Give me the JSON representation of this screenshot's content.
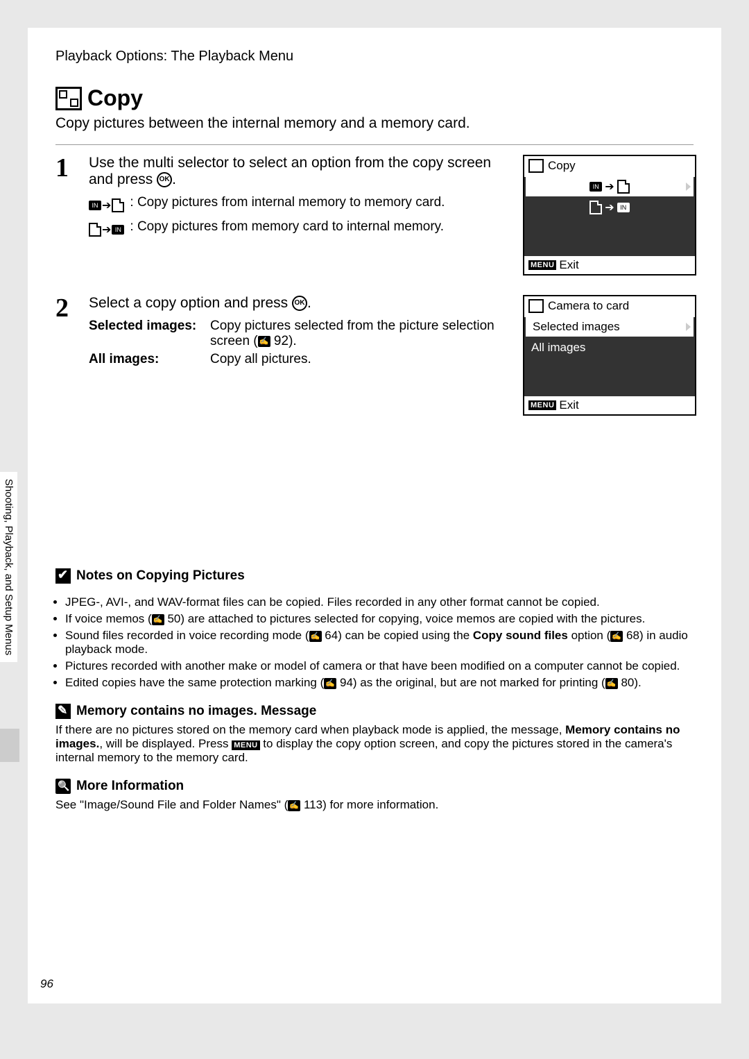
{
  "breadcrumb": "Playback Options: The Playback Menu",
  "heading": "Copy",
  "intro": "Copy pictures between the internal memory and a memory card.",
  "step1": {
    "num": "1",
    "title_a": "Use the multi selector to select an option from the copy screen and press ",
    "title_b": ".",
    "ok": "OK",
    "in_to_card": ": Copy pictures from internal memory to memory card.",
    "card_to_in": ": Copy pictures from memory card to internal memory."
  },
  "step2": {
    "num": "2",
    "title_a": "Select a copy option and press ",
    "title_b": ".",
    "ok": "OK",
    "opt1_label": "Selected images",
    "opt1_desc_a": "Copy pictures selected from the picture selection screen (",
    "opt1_ref": "92",
    "opt1_desc_b": ").",
    "opt2_label": "All images",
    "opt2_desc": "Copy all pictures."
  },
  "screen1": {
    "title": "Copy",
    "exit": "Exit",
    "menu": "MENU"
  },
  "screen2": {
    "title": "Camera to card",
    "row1": "Selected images",
    "row2": "All images",
    "exit": "Exit",
    "menu": "MENU"
  },
  "notes": {
    "head": "Notes on Copying Pictures",
    "b1": "JPEG-, AVI-, and WAV-format files can be copied. Files recorded in any other format cannot be copied.",
    "b2a": "If voice memos (",
    "b2ref": "50",
    "b2b": ") are attached to pictures selected for copying, voice memos are copied with the pictures.",
    "b3a": "Sound files recorded in voice recording mode (",
    "b3ref1": "64",
    "b3b": ") can be copied using the ",
    "b3bold": "Copy sound files",
    "b3c": " option (",
    "b3ref2": "68",
    "b3d": ") in audio playback mode.",
    "b4": "Pictures recorded with another make or model of camera or that have been modified on a computer cannot be copied.",
    "b5a": "Edited copies have the same protection marking (",
    "b5ref1": "94",
    "b5b": ") as the original, but are not marked for printing (",
    "b5ref2": "80",
    "b5c": ")."
  },
  "memory": {
    "head_a": "Memory contains no images.",
    "head_b": " Message",
    "text_a": "If there are no pictures stored on the memory card when playback mode is applied, the message, ",
    "text_bold": "Memory contains no images.",
    "text_b": ", will be displayed. Press ",
    "menu": "MENU",
    "text_c": " to display the copy option screen, and copy the pictures stored in the camera's internal memory to the memory card."
  },
  "more_info": {
    "head": "More Information",
    "text_a": "See \"Image/Sound File and Folder Names\" (",
    "ref": "113",
    "text_b": ") for more information."
  },
  "side_tab": "Shooting, Playback, and Setup Menus",
  "page_num": "96",
  "icons": {
    "in": "IN",
    "arrow": "➔"
  }
}
